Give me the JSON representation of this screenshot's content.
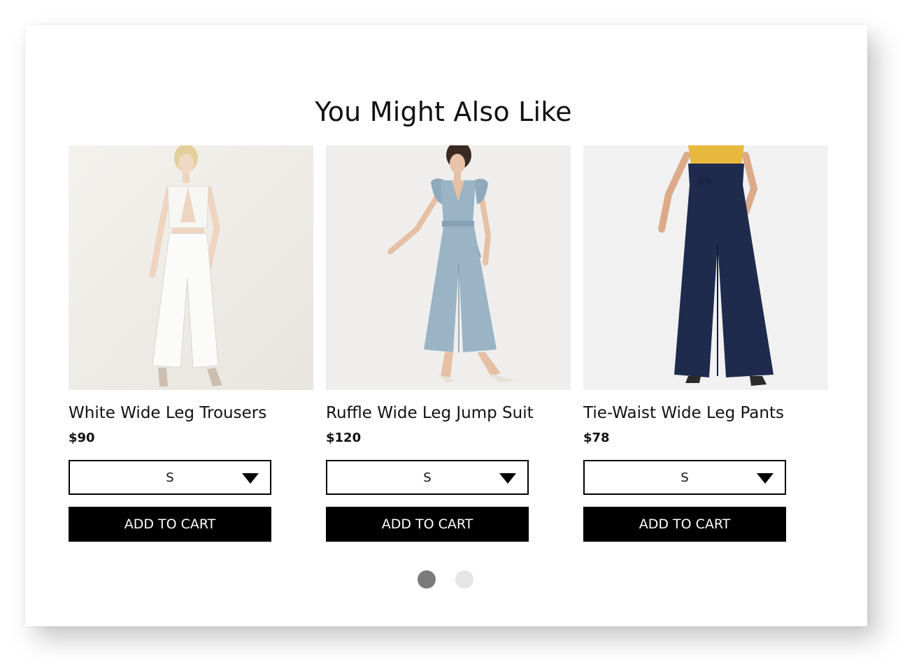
{
  "section": {
    "title": "You Might Also Like"
  },
  "products": [
    {
      "name": "White Wide Leg Trousers",
      "price": "$90",
      "size": "S",
      "add_label": "ADD TO CART",
      "image_alt": "White wide leg trousers outfit"
    },
    {
      "name": "Ruffle Wide Leg Jump Suit",
      "price": "$120",
      "size": "S",
      "add_label": "ADD TO CART",
      "image_alt": "Light blue ruffle jumpsuit"
    },
    {
      "name": "Tie-Waist Wide Leg Pants",
      "price": "$78",
      "size": "S",
      "add_label": "ADD TO CART",
      "image_alt": "Navy tie-waist wide leg pants"
    }
  ],
  "carousel": {
    "pages": 2,
    "active_page": 1
  },
  "colors": {
    "button_bg": "#000000",
    "button_text": "#ffffff",
    "dot_active": "#7a7a7a",
    "dot_inactive": "#e6e6e6"
  }
}
